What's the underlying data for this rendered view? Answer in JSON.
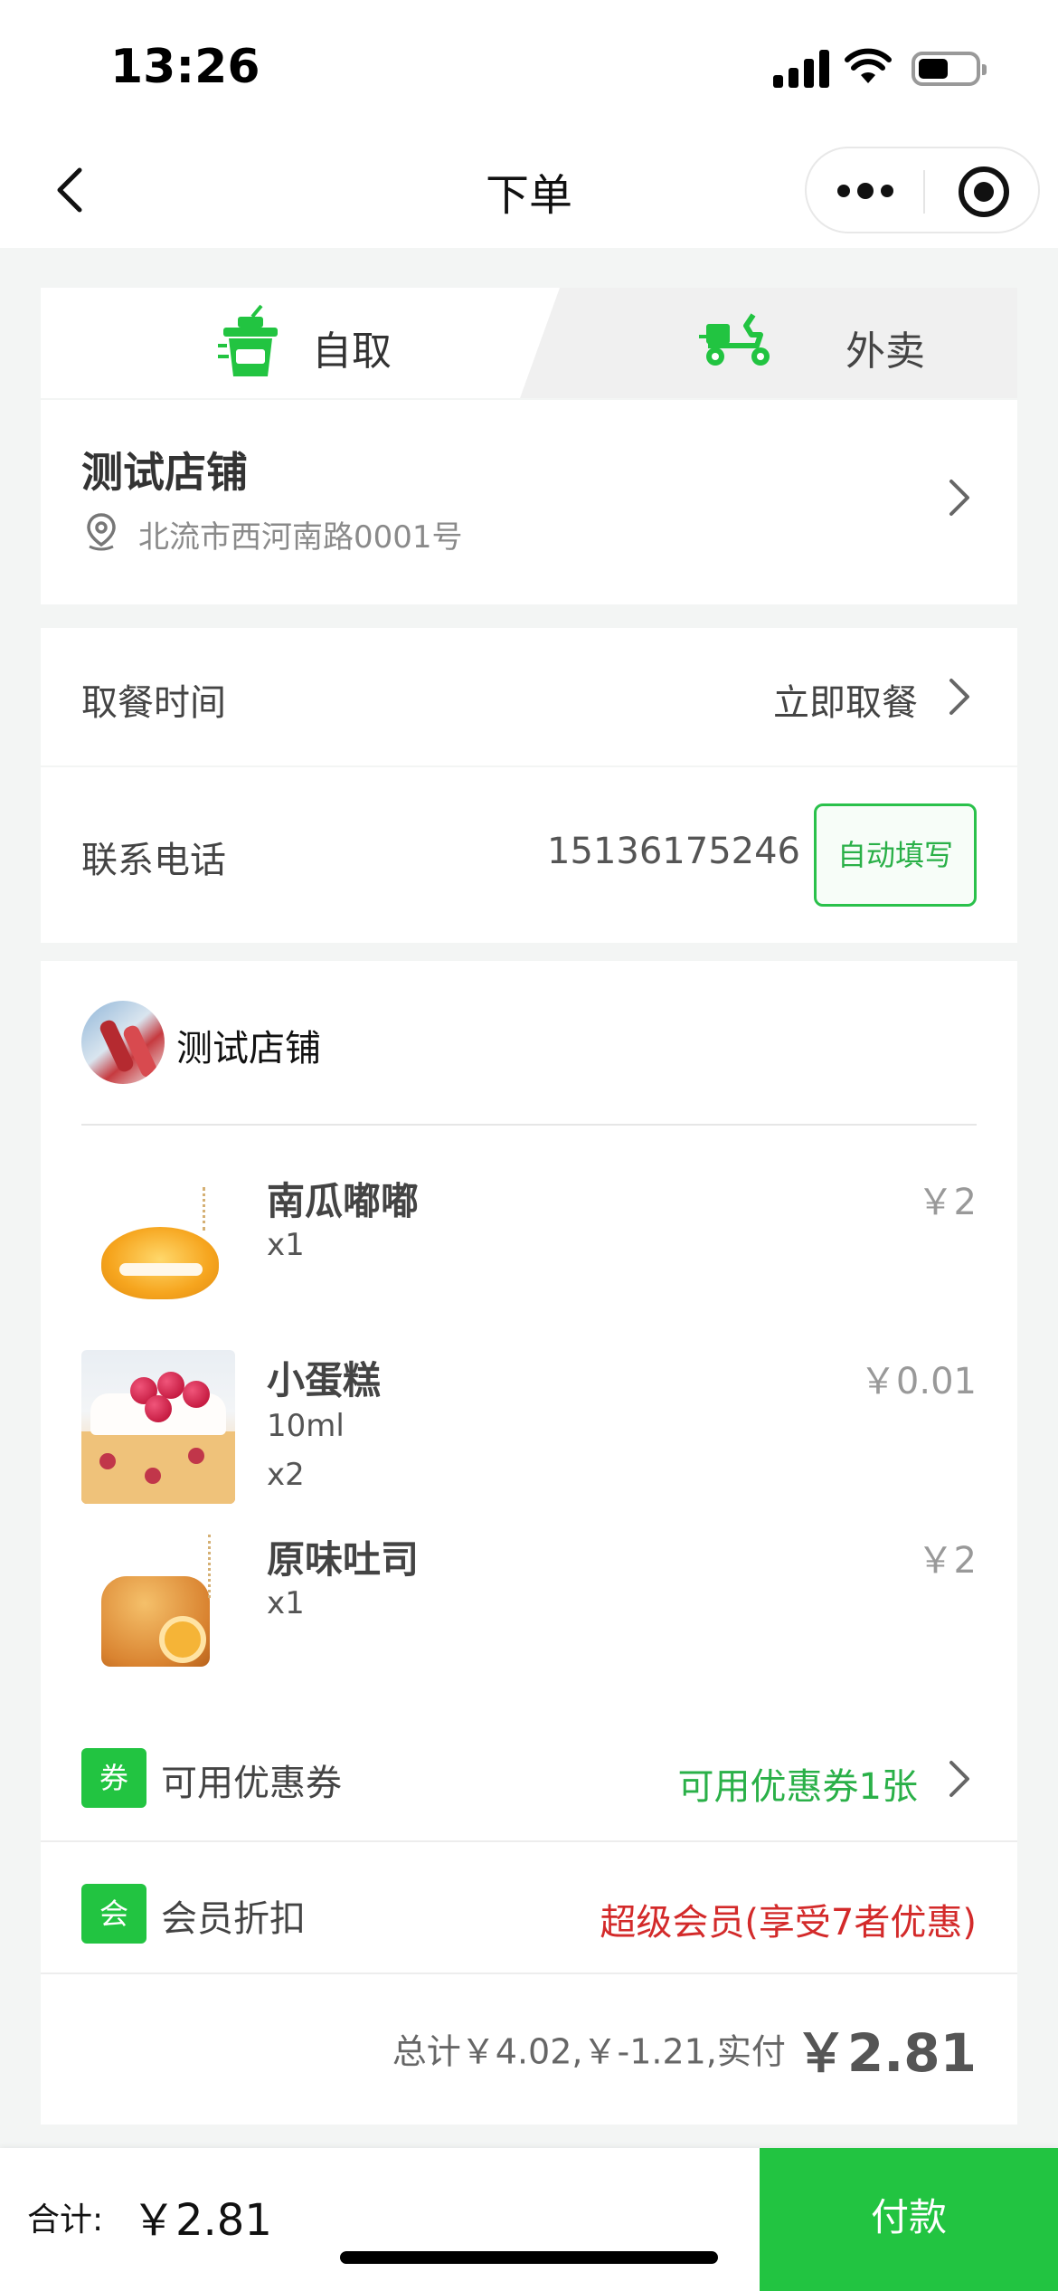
{
  "status_bar": {
    "time": "13:26"
  },
  "nav": {
    "title": "下单"
  },
  "tabs": {
    "pickup_label": "自取",
    "delivery_label": "外卖"
  },
  "store": {
    "name": "测试店铺",
    "address": "北流市西河南路0001号"
  },
  "pickup_time": {
    "label": "取餐时间",
    "value": "立即取餐"
  },
  "contact": {
    "label": "联系电话",
    "phone": "15136175246",
    "autofill_label": "自动填写"
  },
  "order": {
    "shop_name": "测试店铺",
    "items": [
      {
        "name": "南瓜嘟嘟",
        "price": "￥2",
        "spec": "",
        "qty": "x1"
      },
      {
        "name": "小蛋糕",
        "price": "￥0.01",
        "spec": "10ml",
        "qty": "x2"
      },
      {
        "name": "原味吐司",
        "price": "￥2",
        "spec": "",
        "qty": "x1"
      }
    ],
    "coupon": {
      "badge": "券",
      "label": "可用优惠券",
      "value": "可用优惠券1张"
    },
    "member": {
      "badge": "会",
      "label": "会员折扣",
      "value": "超级会员(享受7者优惠)"
    },
    "total_summary": "总计￥4.02,￥-1.21,实付",
    "total_paid": "￥2.81"
  },
  "bottom_bar": {
    "sum_label": "合计:",
    "sum_value": "￥2.81",
    "pay_label": "付款"
  },
  "colors": {
    "brand_green": "#22c441",
    "member_red": "#d32a2a"
  },
  "icons": [
    "back-icon",
    "more-icon",
    "target-icon",
    "cup-icon",
    "scooter-icon",
    "location-icon",
    "chevron-right-icon"
  ]
}
